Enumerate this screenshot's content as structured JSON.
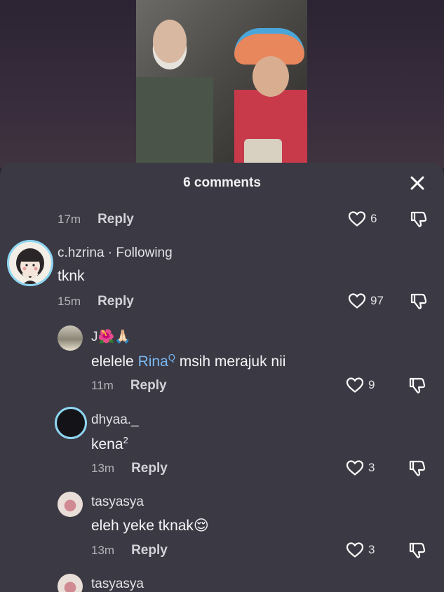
{
  "header": {
    "title": "6 comments"
  },
  "comments": [
    {
      "time": "17m",
      "reply": "Reply",
      "likes": "6"
    },
    {
      "username": "c.hzrina · Following",
      "text": "tknk",
      "time": "15m",
      "reply": "Reply",
      "likes": "97"
    },
    {
      "username": "J🌺🙏🏻",
      "text_pre": "elelele ",
      "mention": "Rina",
      "mention_mark": "Q",
      "text_post": " msih merajuk nii",
      "time": "11m",
      "reply": "Reply",
      "likes": "9"
    },
    {
      "username": "dhyaa._",
      "text": "kena",
      "text_sup": "2",
      "time": "13m",
      "reply": "Reply",
      "likes": "3"
    },
    {
      "username": "tasyasya",
      "text": "eleh yeke tknak😌",
      "time": "13m",
      "reply": "Reply",
      "likes": "3"
    },
    {
      "username": "tasyasya"
    }
  ],
  "icons": {
    "close": "close-icon",
    "like": "heart-outline-icon",
    "dislike": "thumbs-down-icon"
  },
  "colors": {
    "sheet_bg": "#3b3a44",
    "mention": "#7ab7f4",
    "story_ring": "#8fd6f2"
  }
}
